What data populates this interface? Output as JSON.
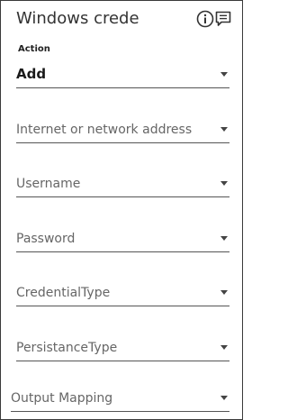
{
  "header": {
    "title": "Windows creder",
    "info_icon": "info-icon",
    "comment_icon": "comment-icon"
  },
  "fields": {
    "action": {
      "label": "Action",
      "value": "Add"
    },
    "address": {
      "placeholder": "Internet or network address"
    },
    "username": {
      "placeholder": "Username"
    },
    "password": {
      "placeholder": "Password"
    },
    "credential_type": {
      "placeholder": "CredentialType"
    },
    "persistance_type": {
      "placeholder": "PersistanceType"
    },
    "output_mapping": {
      "placeholder": "Output Mapping"
    }
  },
  "colors": {
    "border": "#3a3a3a",
    "underline": "#555555",
    "placeholder": "#666666",
    "text": "#1a1a1a"
  }
}
